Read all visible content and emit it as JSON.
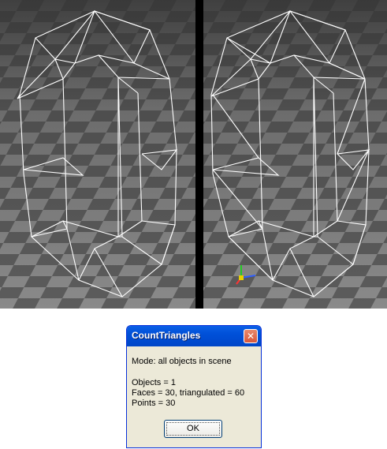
{
  "dialog": {
    "title": "CountTriangles",
    "close_icon": "close-icon",
    "mode": "Mode: all objects in scene",
    "objects": "Objects = 1",
    "faces": "Faces = 30, triangulated = 60",
    "points": "Points = 30",
    "ok_label": "OK"
  },
  "viewports": {
    "floor_color_light": "#8a8a8a",
    "floor_color_dark": "#5c5c5c",
    "wire_color": "#ffffff",
    "left_content": "wireframe-mesh",
    "right_content": "wireframe-mesh-triangulated",
    "gizmo_icon": "axis-gizmo-icon"
  }
}
